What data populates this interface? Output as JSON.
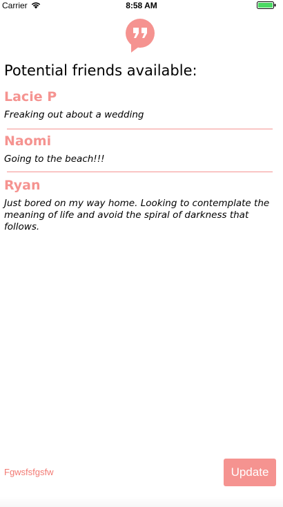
{
  "status_bar": {
    "carrier": "Carrier",
    "time": "8:58 AM",
    "wifi_icon": "wifi-icon",
    "battery_icon": "battery-icon"
  },
  "header": {
    "logo_icon": "quote-bubble-icon",
    "title": "Potential friends available:"
  },
  "friends": [
    {
      "name": "Lacie P",
      "status": "Freaking out about a wedding"
    },
    {
      "name": "Naomi",
      "status": "Going to the beach!!!"
    },
    {
      "name": "Ryan",
      "status": "Just bored on my way home. Looking to contemplate the meaning of life and avoid the spiral of darkness that follows."
    }
  ],
  "footer": {
    "link_text": "Fgwsfsfgsfw",
    "update_label": "Update"
  },
  "colors": {
    "accent": "#f59390",
    "battery": "#4cd964"
  }
}
